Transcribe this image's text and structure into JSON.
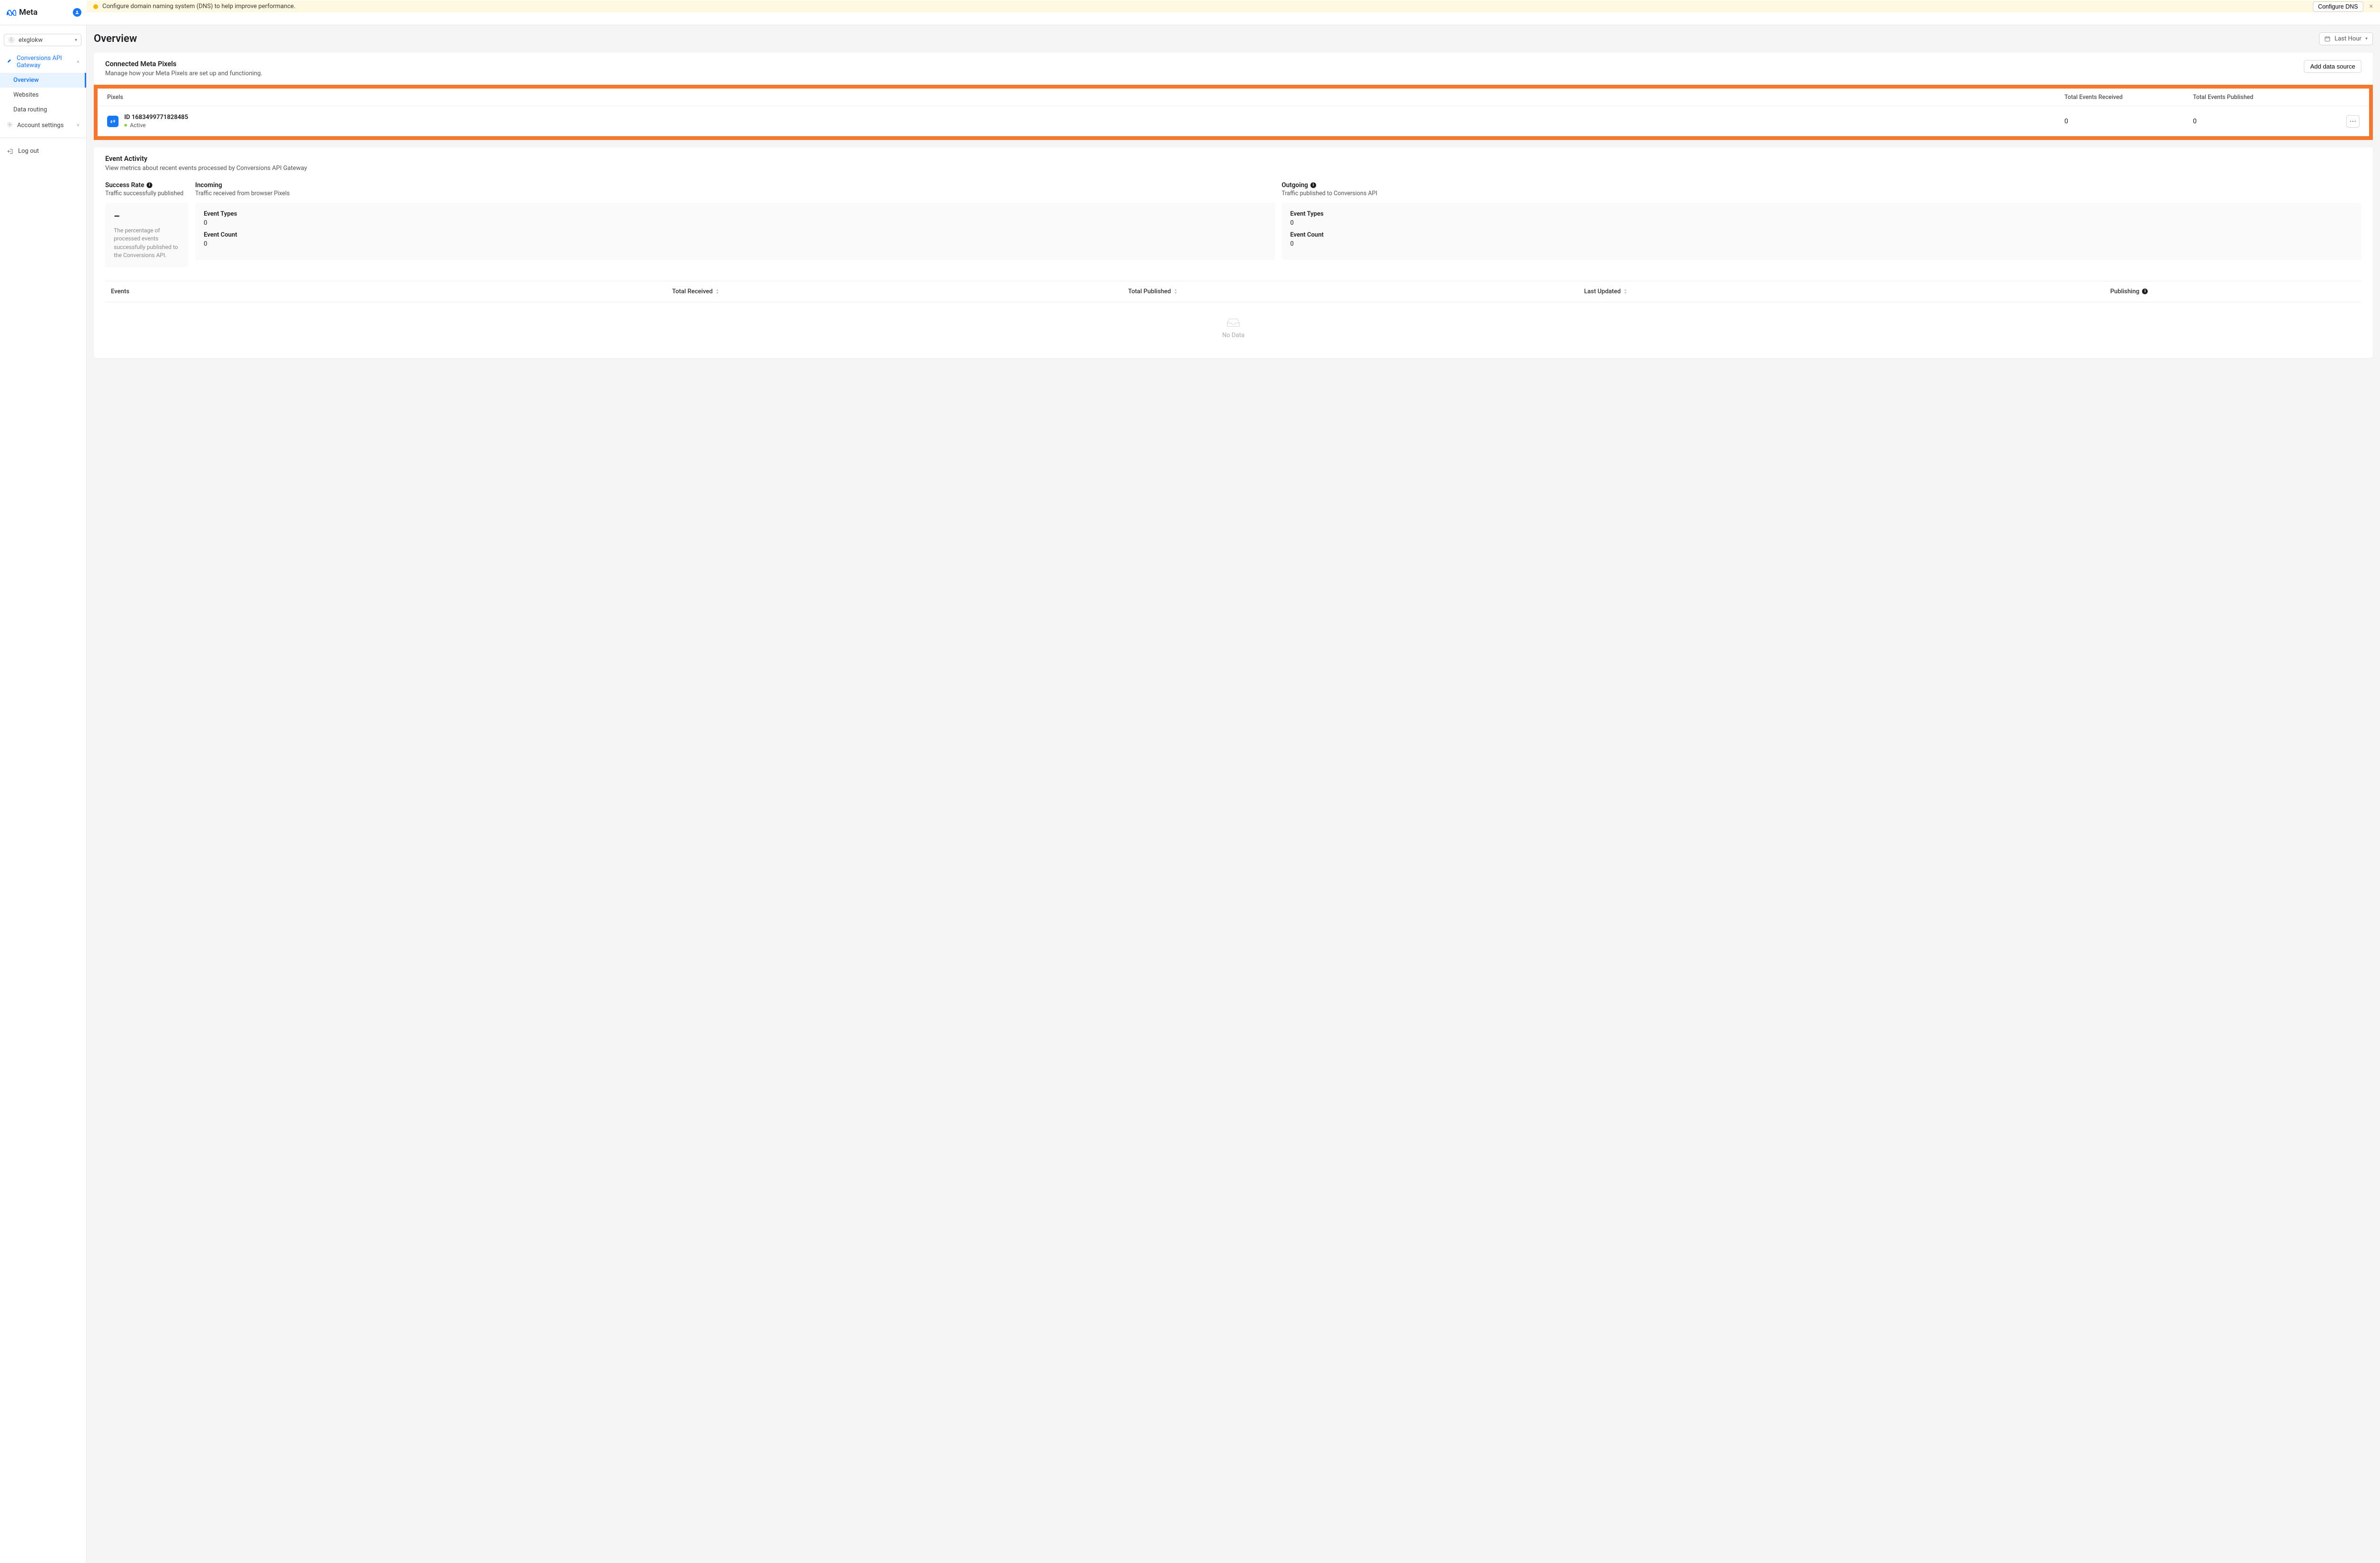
{
  "brand": {
    "name": "Meta"
  },
  "banner": {
    "text": "Configure domain naming system (DNS) to help improve performance.",
    "cta": "Configure DNS"
  },
  "sidebar": {
    "account": "elxglokw",
    "group": "Conversions API Gateway",
    "items": [
      {
        "label": "Overview",
        "active": true
      },
      {
        "label": "Websites",
        "active": false
      },
      {
        "label": "Data routing",
        "active": false
      }
    ],
    "settings": "Account settings",
    "logout": "Log out"
  },
  "page": {
    "title": "Overview",
    "range": "Last Hour"
  },
  "pixels_card": {
    "title": "Connected Meta Pixels",
    "subtitle": "Manage how your Meta Pixels are set up and functioning.",
    "add_btn": "Add data source",
    "columns": {
      "c1": "Pixels",
      "c2": "Total Events Received",
      "c3": "Total Events Published"
    },
    "row": {
      "id_prefix": "ID",
      "id": "1683499771828485",
      "status": "Active",
      "received": "0",
      "published": "0"
    }
  },
  "activity_card": {
    "title": "Event Activity",
    "subtitle": "View metrics about recent events processed by Conversions API Gateway",
    "success": {
      "title": "Success Rate",
      "subtitle": "Traffic successfully published",
      "value": "–",
      "desc": "The percentage of processed events successfully published to the Conversions API."
    },
    "incoming": {
      "title": "Incoming",
      "subtitle": "Traffic received from browser Pixels",
      "types_label": "Event Types",
      "types_value": "0",
      "count_label": "Event Count",
      "count_value": "0"
    },
    "outgoing": {
      "title": "Outgoing",
      "subtitle": "Traffic published to Conversions API",
      "types_label": "Event Types",
      "types_value": "0",
      "count_label": "Event Count",
      "count_value": "0"
    },
    "table": {
      "h1": "Events",
      "h2": "Total Received",
      "h3": "Total Published",
      "h4": "Last Updated",
      "h5": "Publishing",
      "empty": "No Data"
    }
  }
}
